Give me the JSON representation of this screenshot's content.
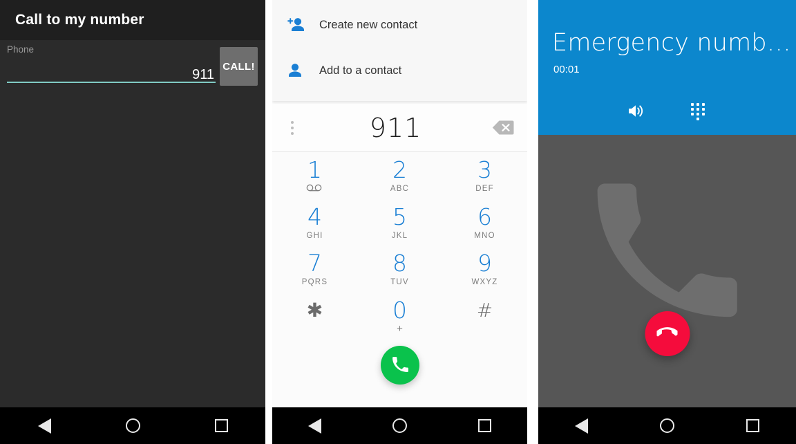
{
  "panels": {
    "app": {
      "title": "Call to my number",
      "field_label": "Phone",
      "field_value": "911",
      "field_placeholder": "Phone",
      "call_button": "CALL!",
      "accent_underline": "#80cbc4",
      "appbar_bg": "#1f1f1f",
      "body_bg": "#2b2b2b"
    },
    "dialer": {
      "actions": [
        {
          "label": "Create new contact",
          "icon": "person-add-icon"
        },
        {
          "label": "Add to a contact",
          "icon": "person-icon"
        }
      ],
      "number": "911",
      "overflow_icon": "overflow-menu-icon",
      "backspace_icon": "backspace-icon",
      "keys": [
        {
          "digit": "1",
          "sub": "",
          "sub_icon": "voicemail-icon",
          "gray": false
        },
        {
          "digit": "2",
          "sub": "ABC",
          "gray": false
        },
        {
          "digit": "3",
          "sub": "DEF",
          "gray": false
        },
        {
          "digit": "4",
          "sub": "GHI",
          "gray": false
        },
        {
          "digit": "5",
          "sub": "JKL",
          "gray": false
        },
        {
          "digit": "6",
          "sub": "MNO",
          "gray": false
        },
        {
          "digit": "7",
          "sub": "PQRS",
          "gray": false
        },
        {
          "digit": "8",
          "sub": "TUV",
          "gray": false
        },
        {
          "digit": "9",
          "sub": "WXYZ",
          "gray": false
        },
        {
          "digit": "✱",
          "sub": "",
          "gray": true
        },
        {
          "digit": "0",
          "sub": "+",
          "gray": false
        },
        {
          "digit": "#",
          "sub": "",
          "gray": true
        }
      ],
      "call_fab_icon": "phone-icon",
      "accent": "#1a7fd4",
      "fab_color": "#0ac24c"
    },
    "call": {
      "name": "Emergency numb…",
      "timer": "00:01",
      "controls": [
        {
          "icon": "speaker-icon",
          "name": "speaker-toggle"
        },
        {
          "icon": "dialpad-icon",
          "name": "dialpad-toggle"
        }
      ],
      "end_call_icon": "end-call-icon",
      "header_bg": "#0c87cd",
      "body_bg": "#565656",
      "end_fab_color": "#f50c3c"
    }
  },
  "navbar": {
    "back": "back-button",
    "home": "home-button",
    "recents": "recents-button"
  }
}
